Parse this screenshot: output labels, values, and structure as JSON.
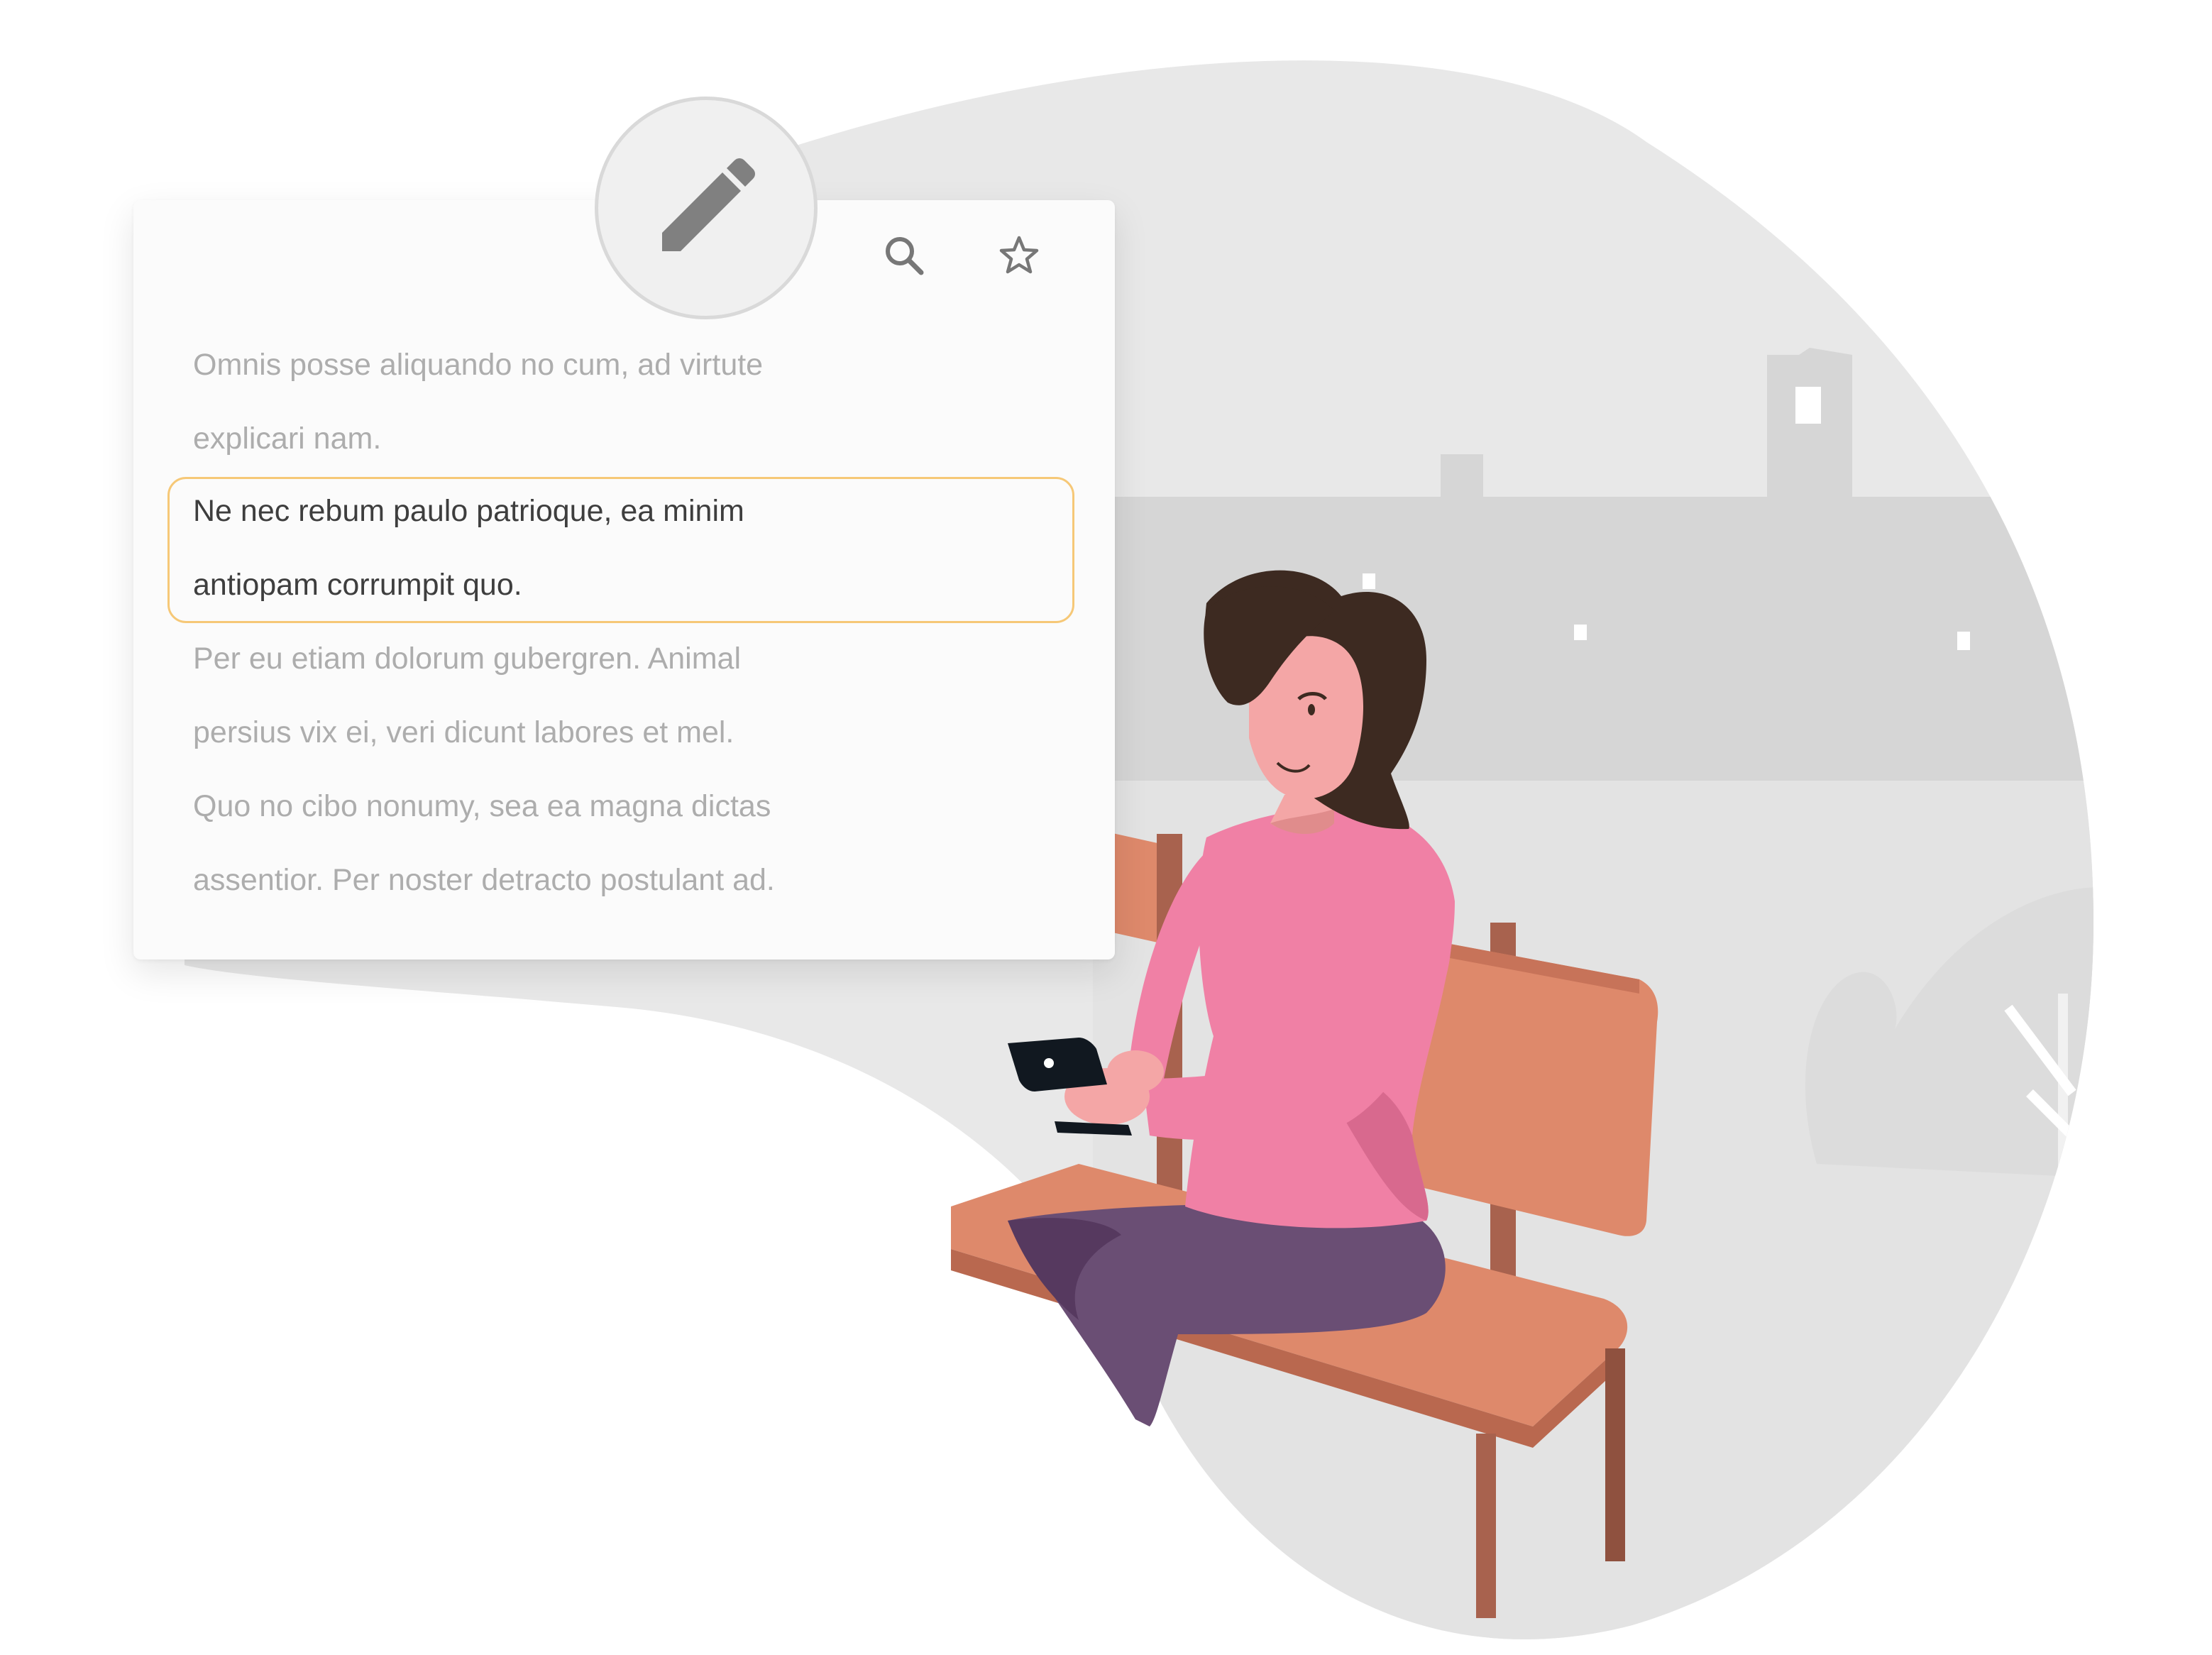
{
  "toolbar": {
    "edit_icon": "pencil-icon",
    "search_icon": "search-icon",
    "favorite_icon": "star-icon"
  },
  "note": {
    "paragraph_1": {
      "line_1": "Omnis posse aliquando no cum, ad virtute",
      "line_2": "explicari nam."
    },
    "selected_paragraph": {
      "line_1": "Ne nec rebum paulo patrioque, ea minim",
      "line_2": "antiopam corrumpit quo."
    },
    "paragraph_3": {
      "line_1": "Per eu etiam dolorum gubergren. Animal",
      "line_2": "persius vix ei, veri dicunt labores et mel."
    },
    "paragraph_4": {
      "line_1": "Quo no cibo nonumy, sea ea magna dictas",
      "line_2": "assentior. Per noster detracto postulant ad."
    }
  },
  "colors": {
    "card_background": "#fbfbfb",
    "highlight_border": "#f6c877",
    "muted_text": "#adadad",
    "active_text": "#3e3e3e",
    "blob_gray": "#e8e8e8",
    "skyline_gray": "#d6d6d6",
    "bench_orange": "#de896b",
    "sweater_pink": "#f080a5",
    "pants_purple": "#6a4e74",
    "hair_brown": "#3d2a21"
  }
}
